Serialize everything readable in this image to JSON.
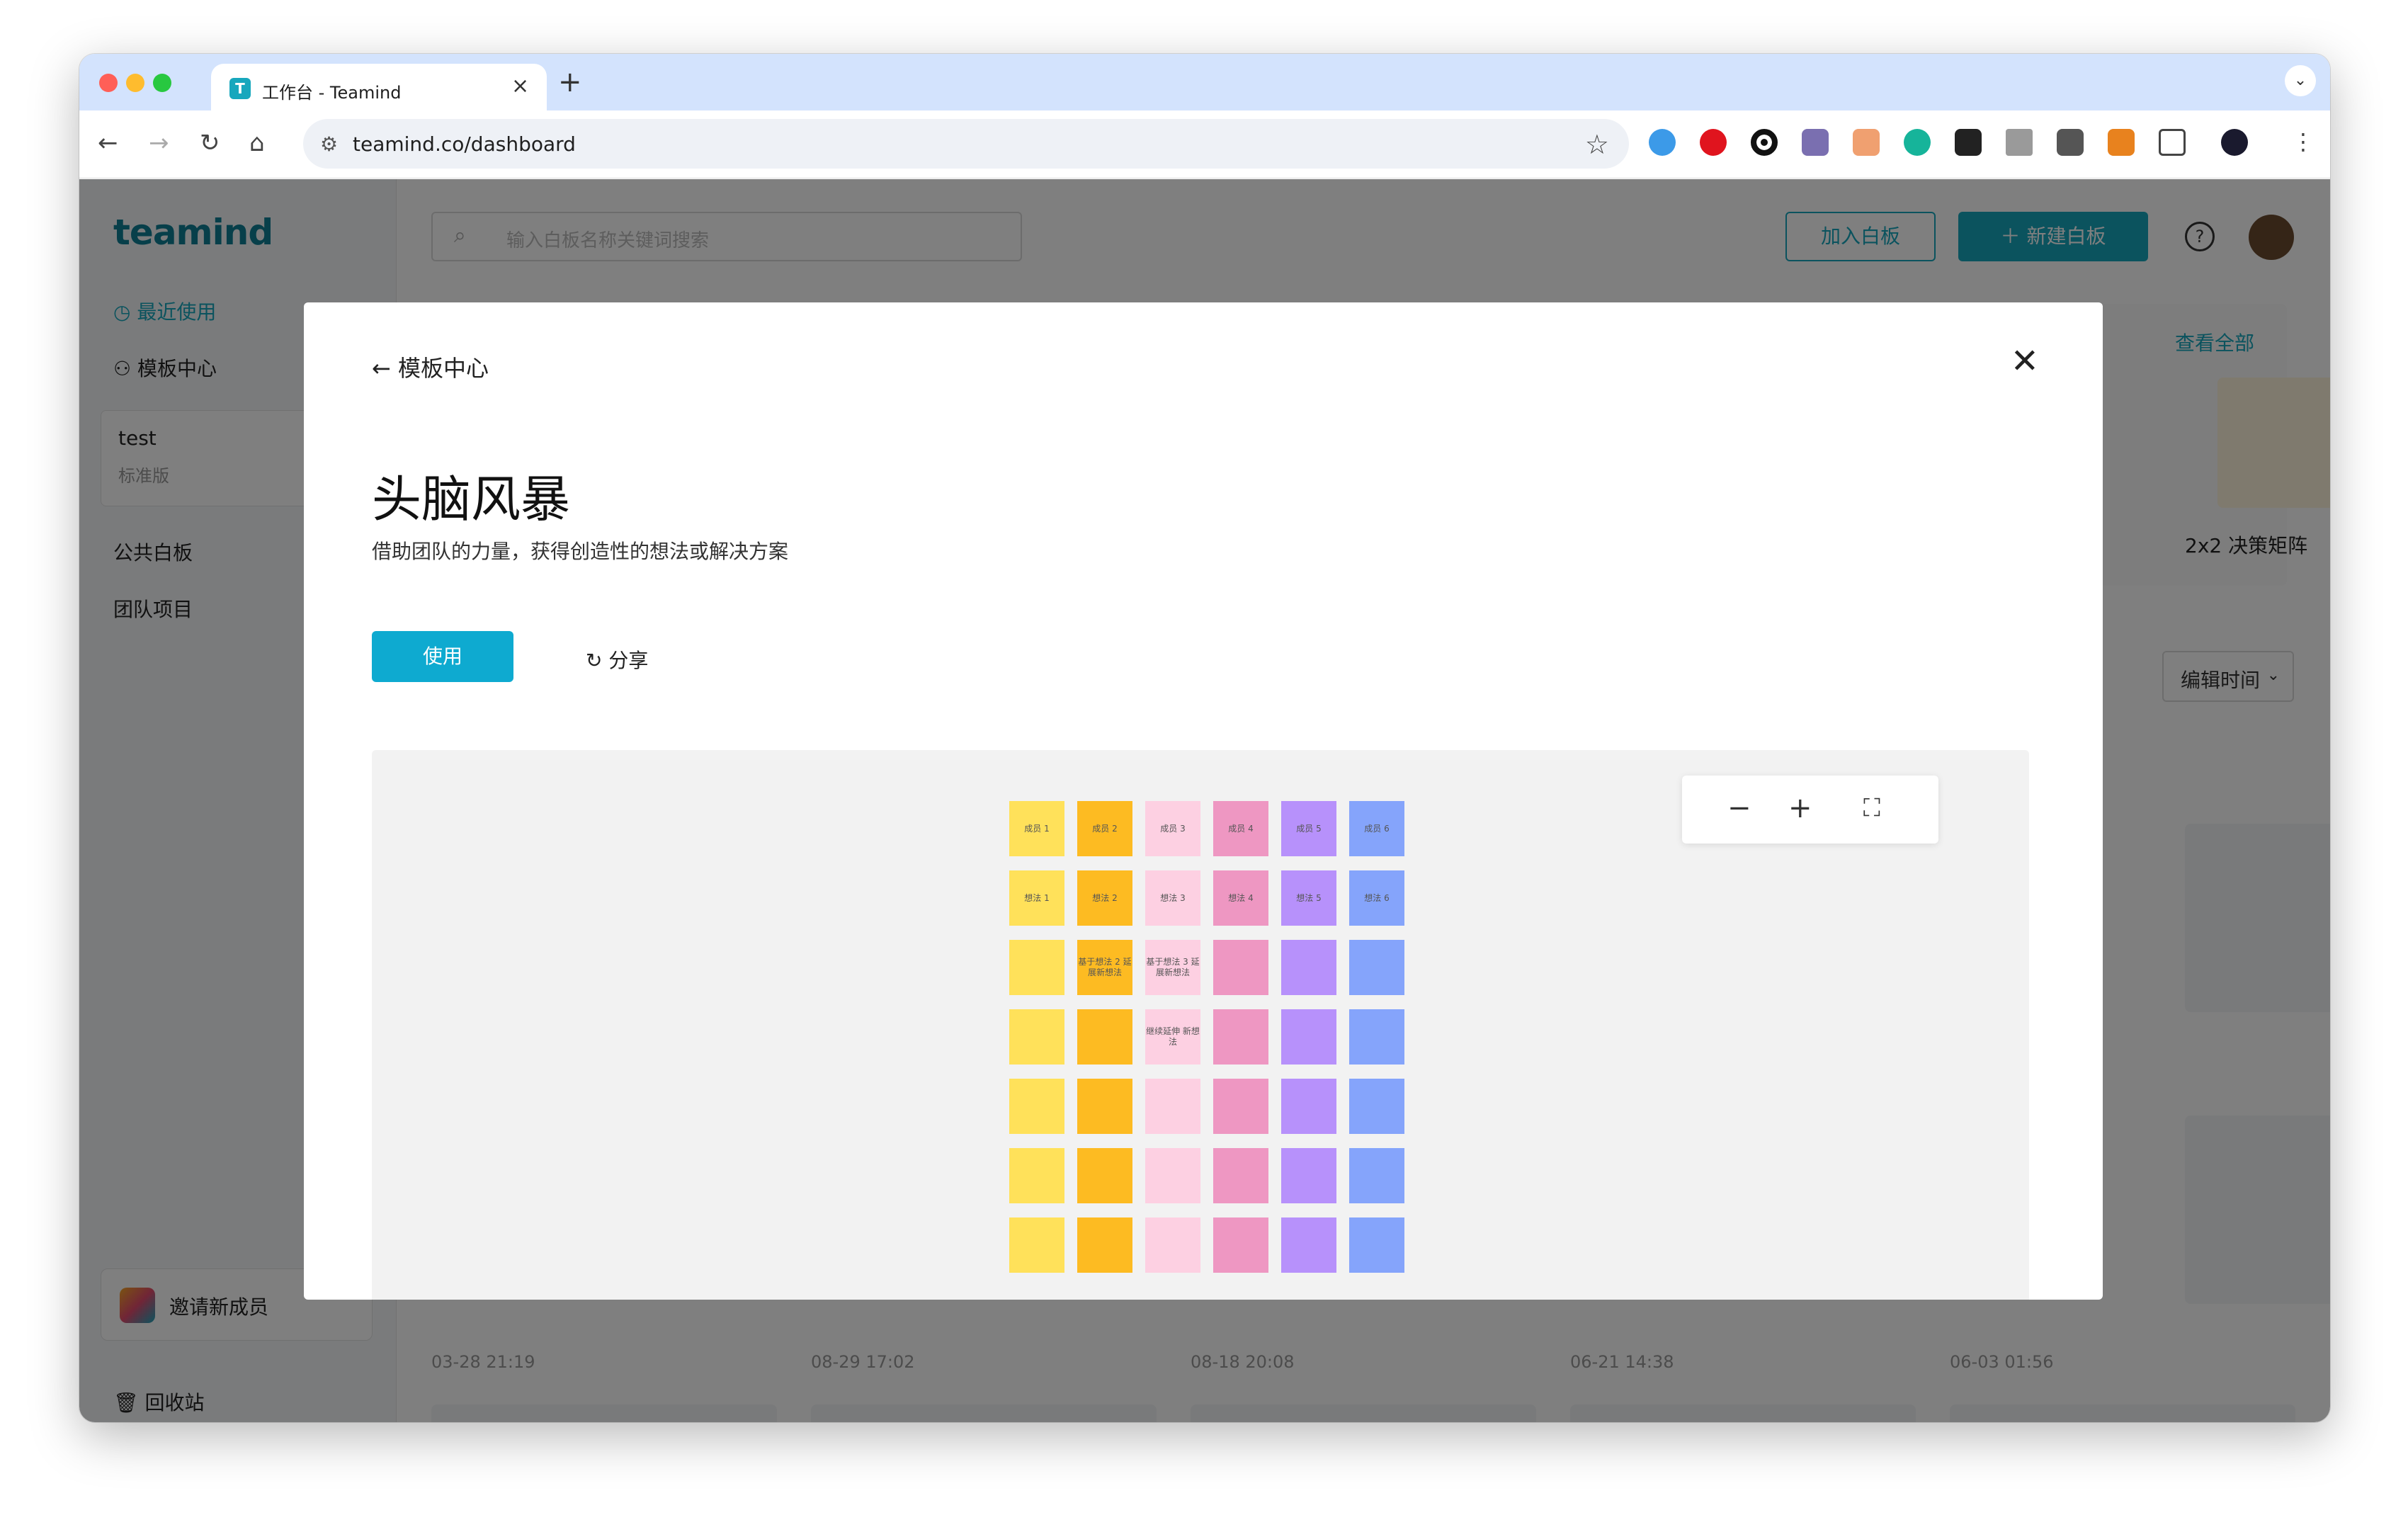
{
  "browser": {
    "tab_title": "工作台 - Teamind",
    "tab_favicon": "T",
    "url": "teamind.co/dashboard"
  },
  "sidebar": {
    "logo": "teamind",
    "recent": "最近使用",
    "templates": "模板中心",
    "workspace_name": "test",
    "workspace_plan": "标准版",
    "public_boards": "公共白板",
    "team_projects": "团队项目",
    "invite": "邀请新成员",
    "trash": "回收站"
  },
  "header": {
    "search_placeholder": "输入白板名称关键词搜索",
    "join_board": "加入白板",
    "new_board": "新建白板"
  },
  "dashboard": {
    "view_all": "查看全部",
    "template_card_label": "2x2 决策矩阵",
    "sort_label": "编辑时间",
    "timestamps": [
      "03-28 21:19",
      "08-29 17:02",
      "08-18 20:08",
      "06-21 14:38",
      "06-03 01:56"
    ]
  },
  "modal": {
    "back_label": "模板中心",
    "title": "头脑风暴",
    "description": "借助团队的力量，获得创造性的想法或解决方案",
    "use_button": "使用",
    "share_button": "分享",
    "preview": {
      "colors": [
        "#ffe15a",
        "#fdbb22",
        "#fdd0e2",
        "#ee97c2",
        "#b791fb",
        "#85a4fb"
      ],
      "header_row": [
        "成员 1",
        "成员 2",
        "成员 3",
        "成员 4",
        "成员 5",
        "成员 6"
      ],
      "idea_row": [
        "想法 1",
        "想法 2",
        "想法 3",
        "想法 4",
        "想法 5",
        "想法 6"
      ],
      "extended": {
        "c2r2": "基于想法 2 延展新想法",
        "c3r2": "基于想法 3 延展新想法",
        "c3r3": "继续延伸 新想法"
      }
    }
  }
}
